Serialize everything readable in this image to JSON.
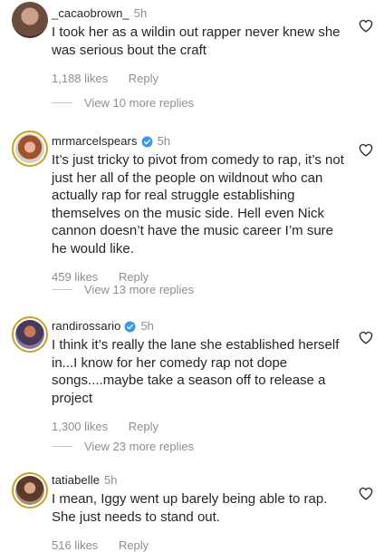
{
  "comments": [
    {
      "username": "_cacaobrown_",
      "time": "5h",
      "verified": false,
      "text": "I took her as a wildin out rapper never knew she was serious bout the craft",
      "likes": "1,188 likes",
      "reply_label": "Reply",
      "view_replies": "View 10 more replies"
    },
    {
      "username": "mrmarcelspears",
      "time": "5h",
      "verified": true,
      "text": "It’s just tricky to pivot from comedy to rap, it’s not just her all of the people on wildnout who can actually rap for real struggle establishing themselves on the music side. Hell even Nick cannon doesn’t have the music career I’m sure he would like.",
      "likes": "459 likes",
      "reply_label": "Reply",
      "view_replies": "View 13 more replies"
    },
    {
      "username": "randirossario",
      "time": "5h",
      "verified": true,
      "text": "I think it’s really the lane she established herself in...I know for her comedy rap not dope songs....maybe take a season off to release a project",
      "likes": "1,300 likes",
      "reply_label": "Reply",
      "view_replies": "View 23 more replies"
    },
    {
      "username": "tatiabelle",
      "time": "5h",
      "verified": false,
      "text": "I mean, Iggy went up barely being able to rap. She just needs to stand out.",
      "likes": "516 likes",
      "reply_label": "Reply"
    }
  ],
  "colors": {
    "verified": "#3897f0",
    "muted": "#8e8e8e",
    "text": "#262626"
  },
  "icons": {
    "like": "heart-outline-icon",
    "verified": "verified-badge-icon"
  }
}
